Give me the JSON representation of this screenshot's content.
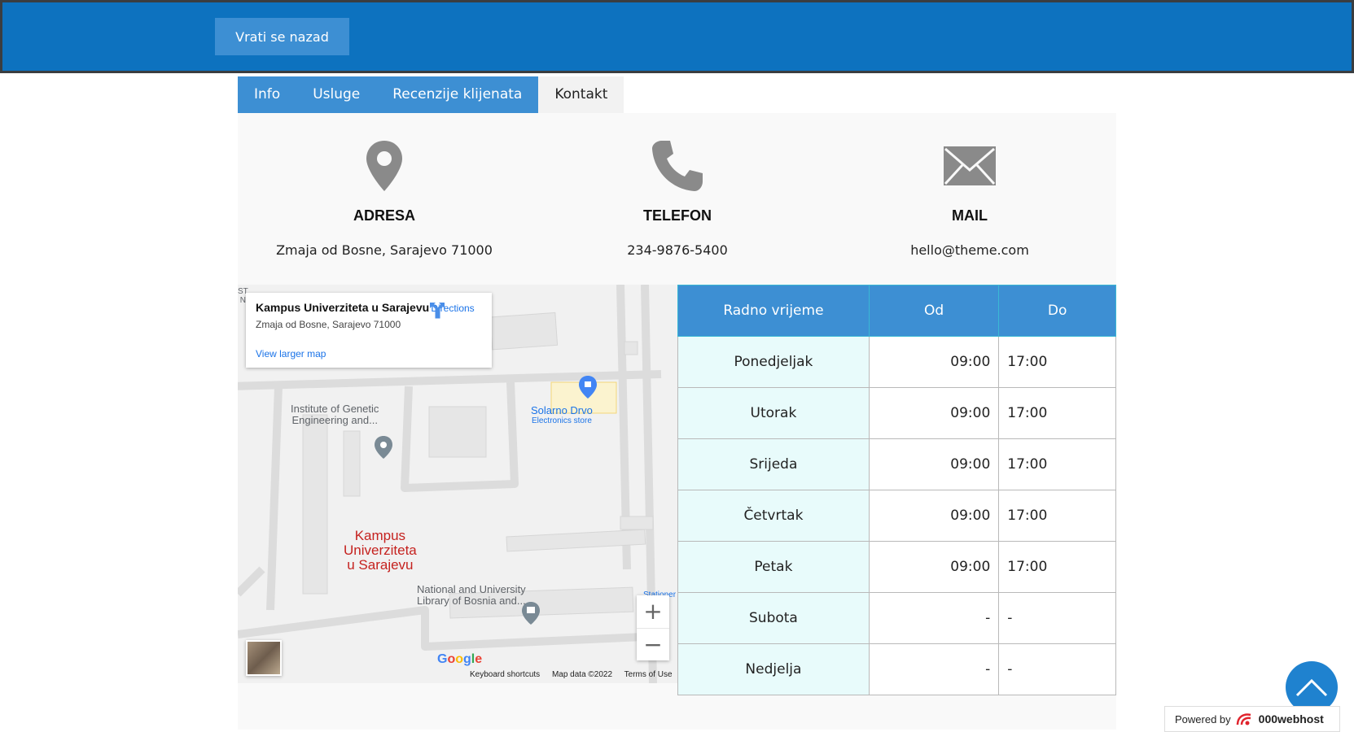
{
  "header": {
    "back_label": "Vrati se nazad"
  },
  "tabs": [
    {
      "label": "Info",
      "active": false
    },
    {
      "label": "Usluge",
      "active": false
    },
    {
      "label": "Recenzije klijenata",
      "active": false
    },
    {
      "label": "Kontakt",
      "active": true
    }
  ],
  "contact": {
    "address": {
      "icon": "map-pin-icon",
      "label": "ADRESA",
      "value": "Zmaja od Bosne, Sarajevo 71000"
    },
    "phone": {
      "icon": "phone-icon",
      "label": "TELEFON",
      "value": "234-9876-5400"
    },
    "mail": {
      "icon": "envelope-icon",
      "label": "MAIL",
      "value": "hello@theme.com"
    }
  },
  "map": {
    "place_title": "Kampus Univerziteta u Sarajevu",
    "place_address": "Zmaja od Bosne, Sarajevo 71000",
    "directions_label": "Directions",
    "larger_map_label": "View larger map",
    "labels": {
      "institute_line1": "Institute of Genetic",
      "institute_line2": "Engineering and...",
      "store_name": "Solarno Drvo",
      "store_type": "Electronics store",
      "campus_line1": "Kampus",
      "campus_line2": "Univerziteta",
      "campus_line3": "u Sarajevu",
      "library_line1": "National and University",
      "library_line2": "Library of Bosnia and...",
      "edge_label": "Stationer",
      "edge_top": "ST",
      "edge_top2": "N"
    },
    "zoom_in": "+",
    "zoom_out": "−",
    "google_logo": "Google",
    "footer": {
      "shortcuts": "Keyboard shortcuts",
      "data": "Map data ©2022",
      "terms": "Terms of Use"
    }
  },
  "hours": {
    "headers": [
      "Radno vrijeme",
      "Od",
      "Do"
    ],
    "rows": [
      {
        "day": "Ponedjeljak",
        "from": "09:00",
        "to": "17:00"
      },
      {
        "day": "Utorak",
        "from": "09:00",
        "to": "17:00"
      },
      {
        "day": "Srijeda",
        "from": "09:00",
        "to": "17:00"
      },
      {
        "day": "Četvrtak",
        "from": "09:00",
        "to": "17:00"
      },
      {
        "day": "Petak",
        "from": "09:00",
        "to": "17:00"
      },
      {
        "day": "Subota",
        "from": "-",
        "to": "-"
      },
      {
        "day": "Nedjelja",
        "from": "-",
        "to": "-"
      }
    ]
  },
  "powered": {
    "prefix": "Powered by",
    "brand": "000webhost"
  },
  "colors": {
    "primary": "#0d72bf",
    "tab": "#3d8fd3",
    "day_cell": "#e8fbfb",
    "campus_label": "#c5221f"
  }
}
